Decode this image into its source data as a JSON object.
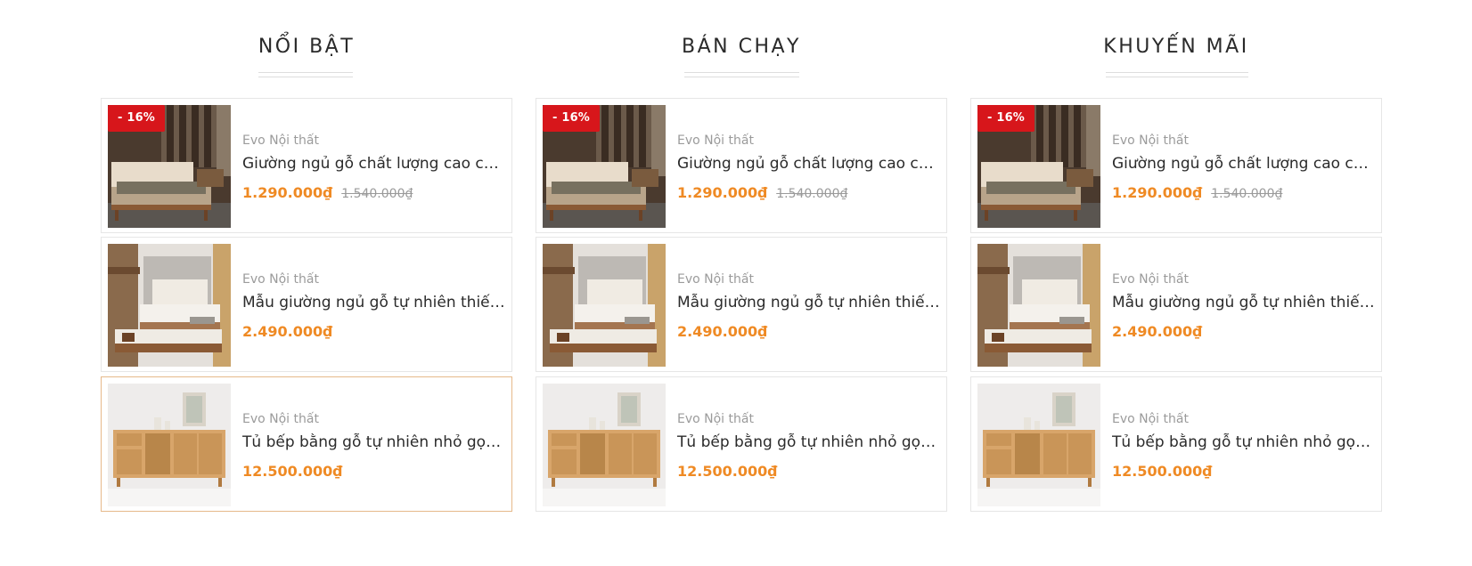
{
  "columns": [
    {
      "title": "NỔI BẬT",
      "products": [
        {
          "badge": "- 16%",
          "vendor": "Evo Nội thất",
          "name": "Giường ngủ gỗ chất lượng cao cho phòng ngủ hiện đại",
          "price": "1.290.000₫",
          "old_price": "1.540.000₫"
        },
        {
          "badge": "",
          "vendor": "Evo Nội thất",
          "name": "Mẫu giường ngủ gỗ tự nhiên thiết kế thông minh",
          "price": "2.490.000₫",
          "old_price": ""
        },
        {
          "badge": "",
          "vendor": "Evo Nội thất",
          "name": "Tủ bếp bằng gỗ tự nhiên nhỏ gọn tiện dụng",
          "price": "12.500.000₫",
          "old_price": ""
        }
      ]
    },
    {
      "title": "BÁN CHẠY",
      "products": [
        {
          "badge": "- 16%",
          "vendor": "Evo Nội thất",
          "name": "Giường ngủ gỗ chất lượng cao cho phòng ngủ hiện đại",
          "price": "1.290.000₫",
          "old_price": "1.540.000₫"
        },
        {
          "badge": "",
          "vendor": "Evo Nội thất",
          "name": "Mẫu giường ngủ gỗ tự nhiên thiết kế thông minh",
          "price": "2.490.000₫",
          "old_price": ""
        },
        {
          "badge": "",
          "vendor": "Evo Nội thất",
          "name": "Tủ bếp bằng gỗ tự nhiên nhỏ gọn tiện dụng",
          "price": "12.500.000₫",
          "old_price": ""
        }
      ]
    },
    {
      "title": "KHUYẾN MÃI",
      "products": [
        {
          "badge": "- 16%",
          "vendor": "Evo Nội thất",
          "name": "Giường ngủ gỗ chất lượng cao cho phòng ngủ hiện đại",
          "price": "1.290.000₫",
          "old_price": "1.540.000₫"
        },
        {
          "badge": "",
          "vendor": "Evo Nội thất",
          "name": "Mẫu giường ngủ gỗ tự nhiên thiết kế thông minh",
          "price": "2.490.000₫",
          "old_price": ""
        },
        {
          "badge": "",
          "vendor": "Evo Nội thất",
          "name": "Tủ bếp bằng gỗ tự nhiên nhỏ gọn tiện dụng",
          "price": "12.500.000₫",
          "old_price": ""
        }
      ]
    }
  ],
  "colors": {
    "price": "#ef8a24",
    "badge": "#d7161b",
    "active_border": "#e6b98a"
  }
}
